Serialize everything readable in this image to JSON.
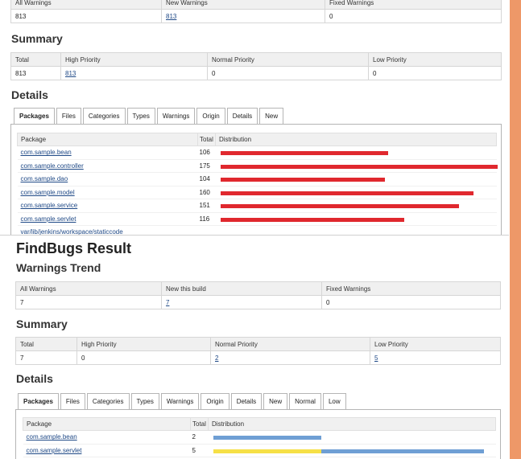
{
  "top": {
    "trend_headers": [
      "All Warnings",
      "New Warnings",
      "Fixed Warnings"
    ],
    "trend_values": {
      "all": "813",
      "new": "813",
      "fixed": "0"
    },
    "summary_title": "Summary",
    "summary_headers": [
      "Total",
      "High Priority",
      "Normal Priority",
      "Low Priority"
    ],
    "summary_values": {
      "total": "813",
      "high": "813",
      "normal": "0",
      "low": "0"
    },
    "details_title": "Details",
    "tabs": [
      "Packages",
      "Files",
      "Categories",
      "Types",
      "Warnings",
      "Origin",
      "Details",
      "New"
    ],
    "table_headers": {
      "package": "Package",
      "total": "Total",
      "distribution": "Distribution"
    },
    "rows": [
      {
        "package": "com.sample.bean",
        "total": "106",
        "high": 106
      },
      {
        "package": "com.sample.controller",
        "total": "175",
        "high": 175
      },
      {
        "package": "com.sample.dao",
        "total": "104",
        "high": 104
      },
      {
        "package": "com.sample.model",
        "total": "160",
        "high": 160
      },
      {
        "package": "com.sample.service",
        "total": "151",
        "high": 151
      },
      {
        "package": "com.sample.servlet",
        "total": "116",
        "high": 116
      },
      {
        "package": "var/lib/jenkins/workspace/staticcode",
        "total": "",
        "high": 0
      }
    ],
    "max_total": 175
  },
  "bottom": {
    "title": "FindBugs Result",
    "trend_title": "Warnings Trend",
    "trend_headers": [
      "All Warnings",
      "New this build",
      "Fixed Warnings"
    ],
    "trend_values": {
      "all": "7",
      "new": "7",
      "fixed": "0"
    },
    "summary_title": "Summary",
    "summary_headers": [
      "Total",
      "High Priority",
      "Normal Priority",
      "Low Priority"
    ],
    "summary_values": {
      "total": "7",
      "high": "0",
      "normal": "2",
      "low": "5"
    },
    "details_title": "Details",
    "tabs": [
      "Packages",
      "Files",
      "Categories",
      "Types",
      "Warnings",
      "Origin",
      "Details",
      "New",
      "Normal",
      "Low"
    ],
    "table_headers": {
      "package": "Package",
      "total": "Total",
      "distribution": "Distribution"
    },
    "rows": [
      {
        "package": "com.sample.bean",
        "total": "2",
        "normal": 0,
        "low": 2
      },
      {
        "package": "com.sample.servlet",
        "total": "5",
        "normal": 2,
        "low": 3
      }
    ],
    "max_total": 5
  },
  "colors": {
    "high": "#e0282e",
    "normal": "#f6e047",
    "low": "#6f9fd4",
    "scrollbar": "#ee9868"
  }
}
